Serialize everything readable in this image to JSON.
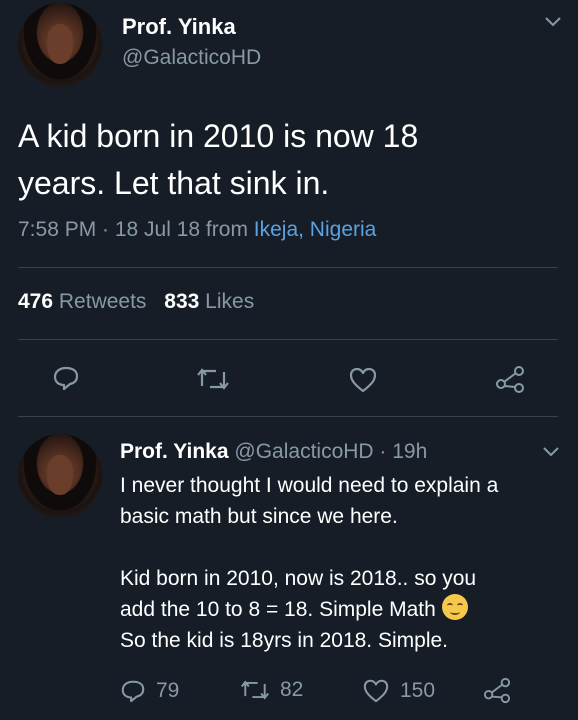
{
  "main_tweet": {
    "author_name": "Prof. Yinka",
    "author_handle": "@GalacticoHD",
    "text_line1": "A kid born in 2010 is now 18",
    "text_line2": "years. Let that sink in.",
    "timestamp": "7:58 PM · 18 Jul 18 from",
    "location": "Ikeja, Nigeria",
    "retweets_count": "476",
    "retweets_label": "Retweets",
    "likes_count": "833",
    "likes_label": "Likes"
  },
  "reply_tweet": {
    "author_name": "Prof. Yinka",
    "author_handle": "@GalacticoHD",
    "time": "· 19h",
    "line1": "I never thought I would need to explain a",
    "line2": "basic math but since we here.",
    "line3": "Kid born in 2010, now is 2018.. so you",
    "line4": "add the 10 to 8 = 18. Simple Math",
    "line5": "So the kid is 18yrs in 2018. Simple.",
    "reply_count": "79",
    "retweet_count": "82",
    "like_count": "150"
  },
  "icons": {
    "reply": "reply-icon",
    "retweet": "retweet-icon",
    "like": "heart-icon",
    "share": "share-icon",
    "chevron": "chevron-down-icon",
    "emoji": "relieved-face-emoji"
  },
  "colors": {
    "background": "#161d27",
    "text": "#ffffff",
    "muted": "#8899a6",
    "link": "#5aa3e0"
  }
}
